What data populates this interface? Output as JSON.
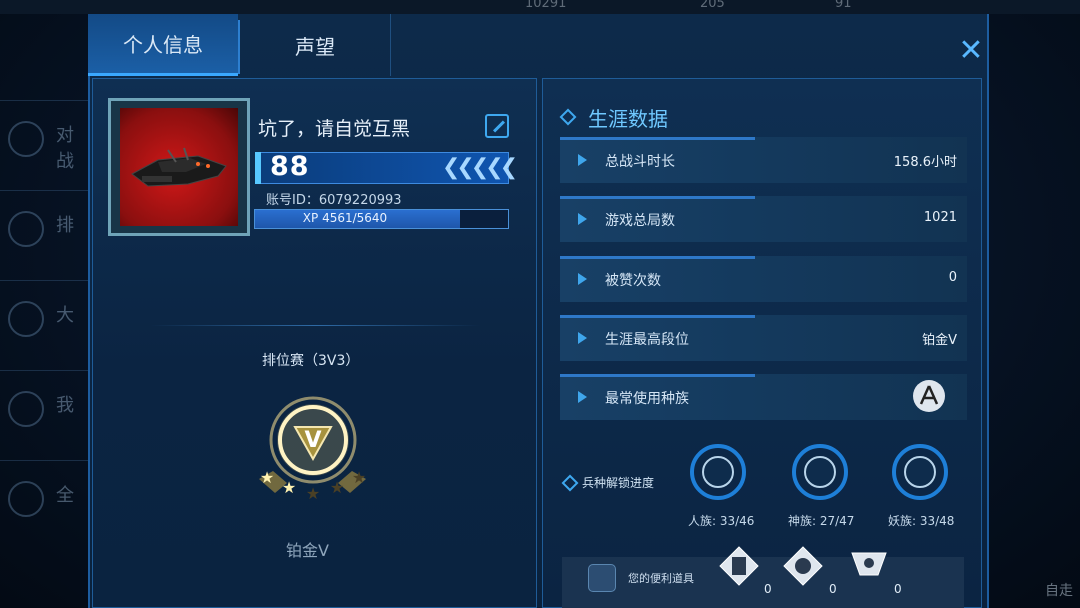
{
  "topbar": {
    "stat1": "10291",
    "stat2": "205",
    "stat3": "91"
  },
  "background_nav": [
    "对战",
    "排",
    "大",
    "我",
    "全"
  ],
  "background_right": "自走",
  "tabs": {
    "profile": "个人信息",
    "reputation": "声望"
  },
  "profile": {
    "name": "坑了，请自觉互黑",
    "level": "88",
    "chevrons": "❮❮❮❮❮",
    "account_id": "账号ID：6079220993",
    "xp_text": "XP 4561/5640",
    "xp_fraction": 0.809
  },
  "ranked": {
    "label": "排位赛（3V3）",
    "emblem_letter": "V",
    "stars_filled": 2,
    "stars_total": 5,
    "tier": "铂金Ⅴ"
  },
  "career": {
    "title": "生涯数据",
    "stats": [
      {
        "label": "总战斗时长",
        "value": "158.6小时",
        "fill": 0.48
      },
      {
        "label": "游戏总局数",
        "value": "1021",
        "fill": 0.48
      },
      {
        "label": "被赞次数",
        "value": "0",
        "fill": 0.48
      },
      {
        "label": "生涯最高段位",
        "value": "铂金Ⅴ",
        "fill": 0.48
      },
      {
        "label": "最常使用种族",
        "value": "",
        "fill": 0.48
      }
    ]
  },
  "unlock": {
    "label": "兵种解锁进度",
    "races": [
      {
        "name": "人族",
        "text": "人族: 33/46",
        "progress": 0.717
      },
      {
        "name": "神族",
        "text": "神族: 27/47",
        "progress": 0.574
      },
      {
        "name": "妖族",
        "text": "妖族: 33/48",
        "progress": 0.687
      }
    ]
  },
  "items": {
    "label": "您的便利道具",
    "slots": [
      {
        "count": "0"
      },
      {
        "count": "0"
      },
      {
        "count": "0"
      }
    ]
  },
  "colors": {
    "accent": "#3ea8f0",
    "panel": "#0b2442",
    "highlight": "#6fc8ff"
  }
}
